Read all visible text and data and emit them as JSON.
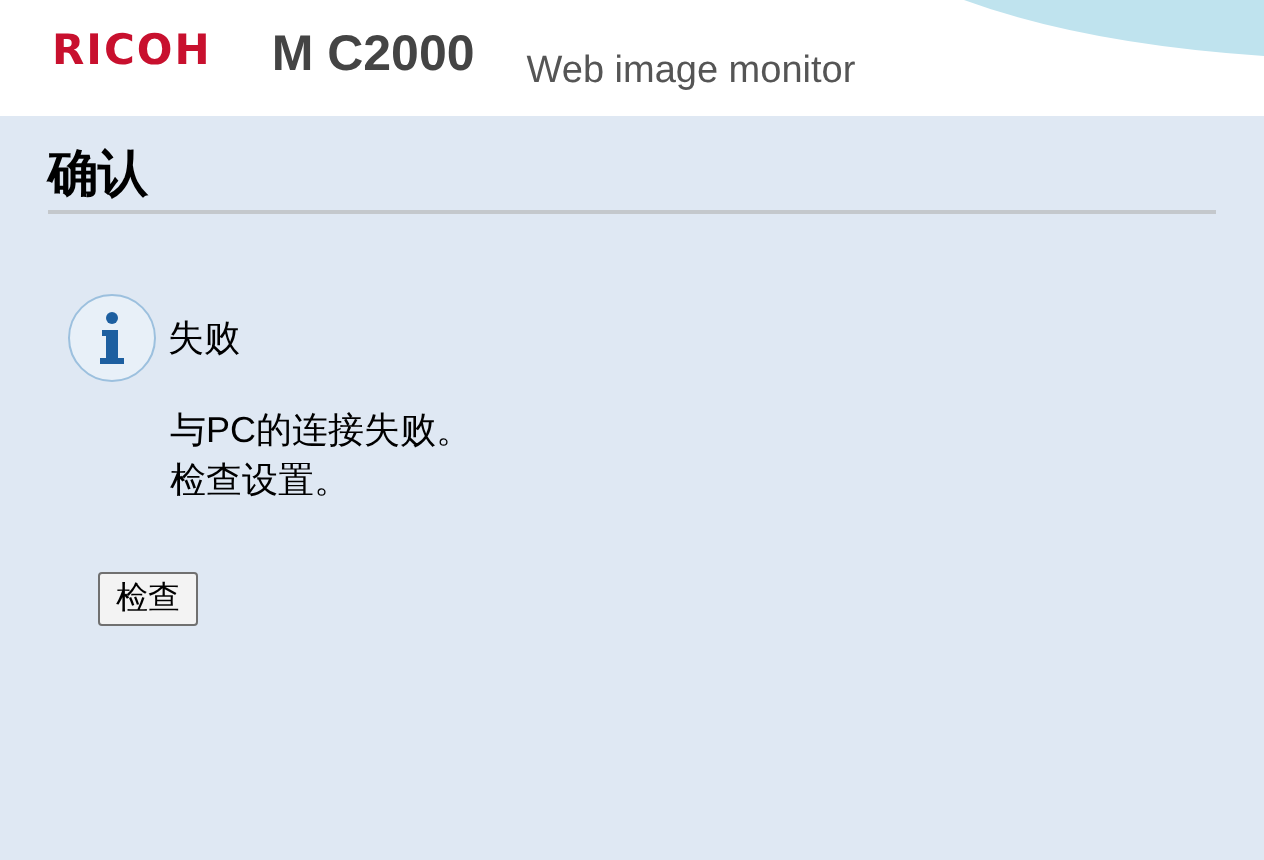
{
  "header": {
    "brand": "RICOH",
    "model": "M C2000",
    "product": "Web image monitor"
  },
  "page": {
    "title": "确认"
  },
  "message": {
    "heading": "失败",
    "lines": [
      "与PC的连接失败。",
      "检查设置。"
    ]
  },
  "buttons": [
    "检查"
  ]
}
